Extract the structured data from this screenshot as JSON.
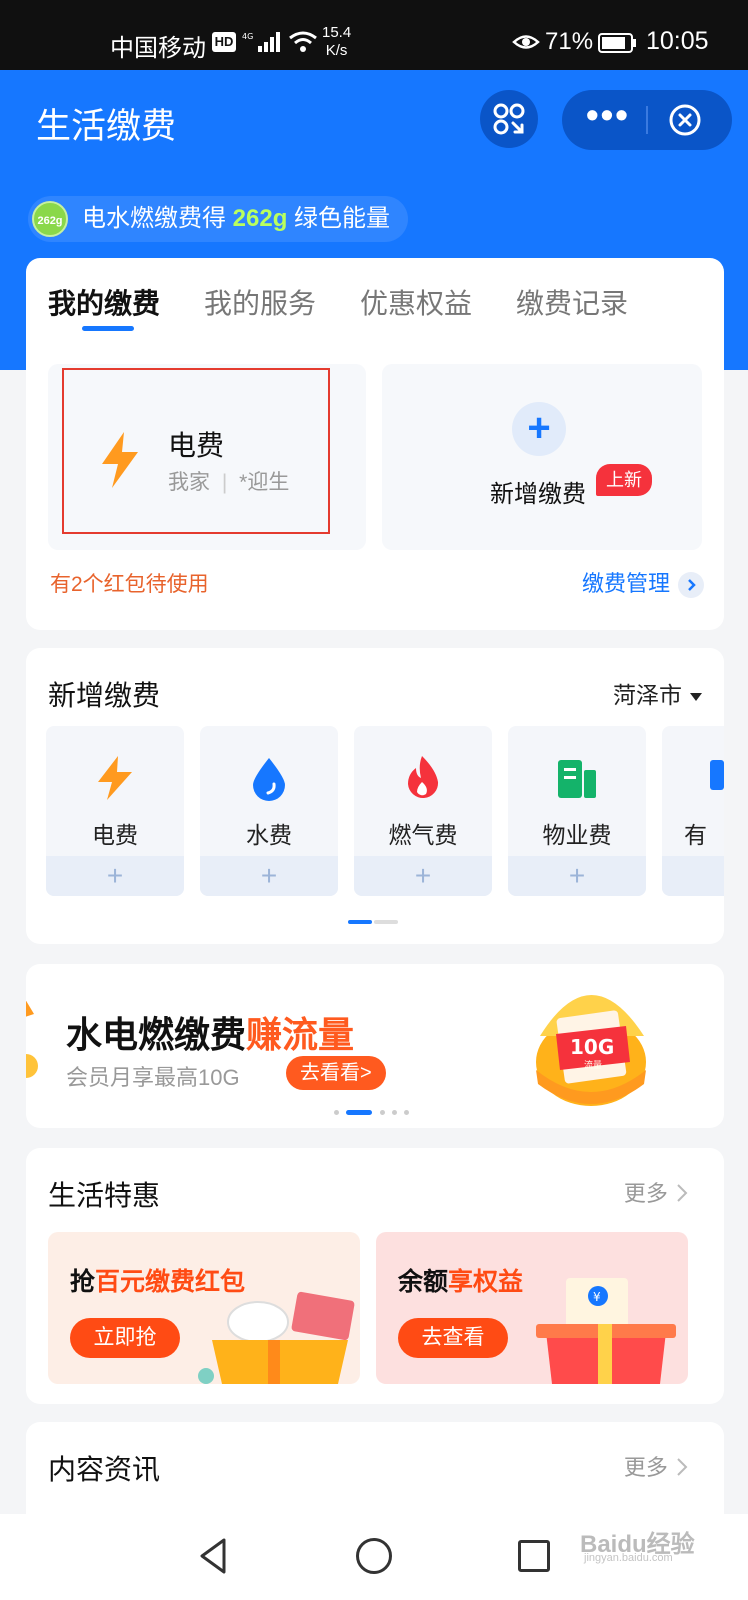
{
  "status_bar": {
    "carrier": "中国移动",
    "hd": "HD",
    "speed_value": "15.4",
    "speed_unit": "K/s",
    "battery": "71%",
    "time": "10:05"
  },
  "header": {
    "title": "生活缴费",
    "energy_badge": "262g",
    "energy_prefix": "电水燃缴费得",
    "energy_amount": "262g",
    "energy_suffix": "绿色能量"
  },
  "tabs": [
    "我的缴费",
    "我的服务",
    "优惠权益",
    "缴费记录"
  ],
  "my_bills": {
    "bill_name": "电费",
    "bill_account": "我家",
    "bill_holder": "*迎生",
    "add_label": "新增缴费",
    "new_badge": "上新",
    "coupons": "有2个红包待使用",
    "manage": "缴费管理"
  },
  "new_payment": {
    "title": "新增缴费",
    "city": "菏泽市",
    "services": [
      "电费",
      "水费",
      "燃气费",
      "物业费",
      "有线"
    ],
    "add_symbol": "+"
  },
  "promo": {
    "title_main": "水电燃缴费",
    "title_highlight": "赚流量",
    "subtitle": "会员月享最高10G",
    "button": "去看看>",
    "badge_10g": "10G",
    "badge_text": "流量"
  },
  "deals": {
    "title": "生活特惠",
    "more": "更多",
    "items": [
      {
        "prefix": "抢",
        "highlight": "百元缴费红包",
        "button": "立即抢",
        "color": "#fdeee6"
      },
      {
        "prefix": "余额",
        "highlight": "享权益",
        "button": "去查看",
        "color": "#fde0df"
      }
    ]
  },
  "news": {
    "title": "内容资讯",
    "more": "更多"
  },
  "watermark": {
    "brand": "Baidu经验",
    "url": "jingyan.baidu.com"
  },
  "colors": {
    "primary": "#1677ff",
    "orange": "#ff5a1f",
    "red_frame": "#e43b2f",
    "energy_green": "#b9ff5e"
  }
}
